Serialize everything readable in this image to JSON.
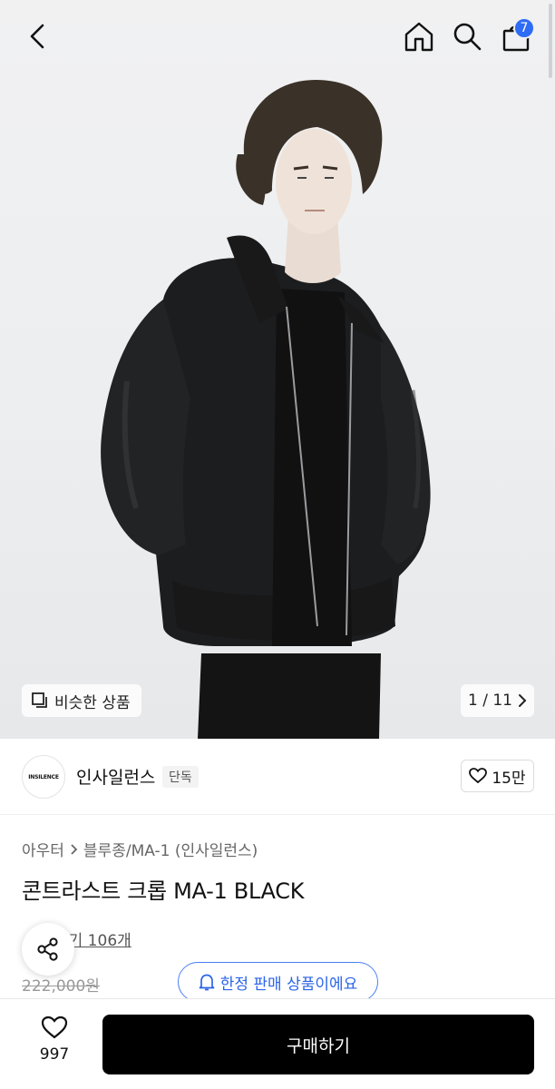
{
  "header": {
    "back_icon": "chevron-left-icon",
    "home_icon": "home-icon",
    "search_icon": "search-icon",
    "cart_icon": "shopping-bag-icon",
    "cart_count": "7",
    "badge_color": "#2f6cf6"
  },
  "gallery": {
    "similar_label": "비슷한 상품",
    "similar_icon": "copy-icon",
    "pager_text": "1 / 11",
    "pager_icon": "chevron-right-icon"
  },
  "brand": {
    "logo_text": "INSILENCE",
    "name": "인사일런스",
    "tag": "단독",
    "like_count": "15만",
    "like_icon": "heart-icon"
  },
  "product": {
    "breadcrumb": [
      "아우터",
      "블루종/MA-1 (인사일런스)"
    ],
    "title": "콘트라스트 크롭 MA-1 BLACK",
    "review_link": "후기 106개",
    "original_price": "222,000원",
    "limited_label": "한정 판매 상품이에요",
    "limited_icon": "bell-icon",
    "accent_color": "#2b64e8"
  },
  "bottom_bar": {
    "wish_icon": "heart-icon",
    "wish_count": "997",
    "buy_label": "구매하기"
  },
  "share": {
    "icon": "share-icon"
  }
}
